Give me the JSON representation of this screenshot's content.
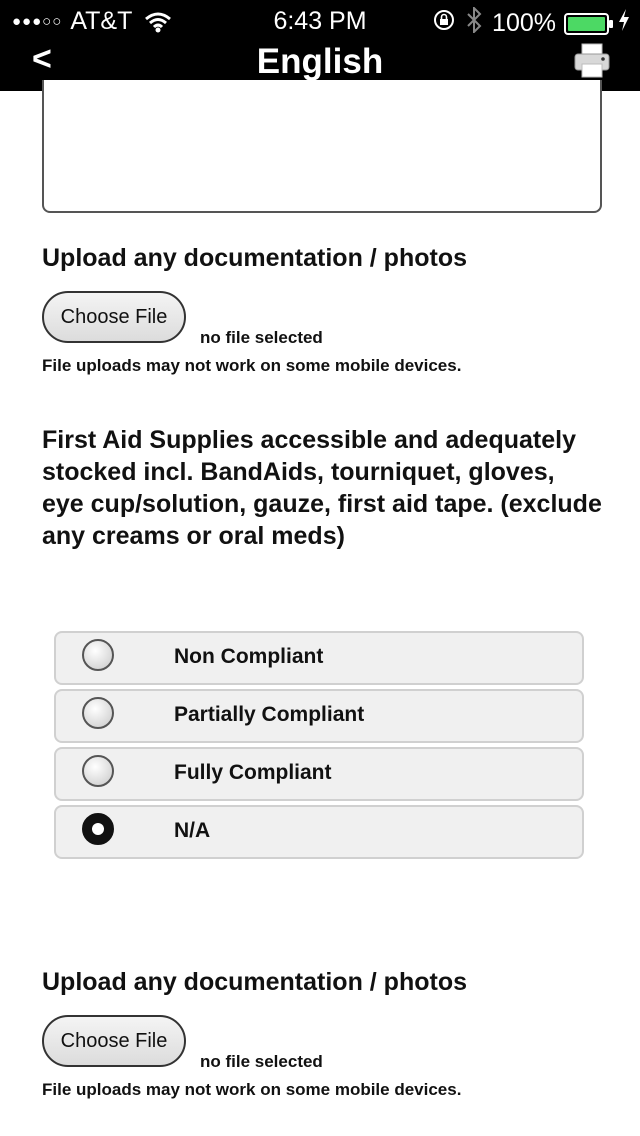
{
  "status_bar": {
    "signal_dots": "●●●○○",
    "carrier": "AT&T",
    "time": "6:43 PM",
    "battery_percent": "100%",
    "icons": [
      "wifi-icon",
      "orientation-lock-icon",
      "bluetooth-icon",
      "battery-icon",
      "charging-bolt-icon"
    ],
    "battery_level": 1.0,
    "battery_color": "#4cd964"
  },
  "nav": {
    "back_label": "<",
    "title": "English",
    "print_icon": "printer-icon"
  },
  "upload_1": {
    "label": "Upload any documentation / photos",
    "button_label": "Choose File",
    "status": "no file selected",
    "note": "File uploads may not work on some mobile devices."
  },
  "question": {
    "text": "First Aid Supplies accessible and adequately stocked incl. BandAids, tourniquet, gloves, eye cup/solution, gauze, first aid tape. (exclude any creams or oral meds)",
    "options": [
      {
        "label": "Non Compliant",
        "checked": false
      },
      {
        "label": "Partially Compliant",
        "checked": false
      },
      {
        "label": "Fully Compliant",
        "checked": false
      },
      {
        "label": "N/A",
        "checked": true
      }
    ]
  },
  "upload_2": {
    "label": "Upload any documentation / photos",
    "button_label": "Choose File",
    "status": "no file selected",
    "note": "File uploads may not work on some mobile devices."
  }
}
